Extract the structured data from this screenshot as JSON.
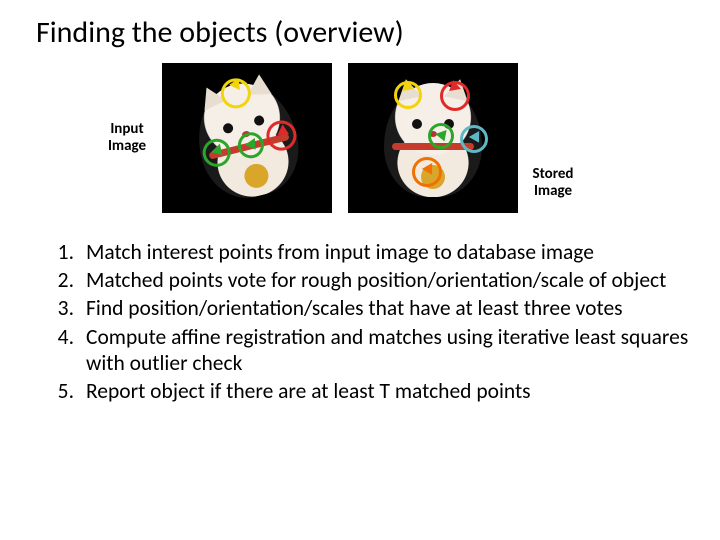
{
  "title": "Finding the objects (overview)",
  "images": {
    "input_label": "Input Image",
    "stored_label": "Stored Image"
  },
  "steps": [
    "Match interest points from input image to database image",
    "Matched points vote for rough position/orientation/scale of object",
    "Find position/orientation/scales that have at least three votes",
    "Compute affine registration and matches using iterative least squares with outlier check",
    "Report object if there are at least T matched points"
  ]
}
